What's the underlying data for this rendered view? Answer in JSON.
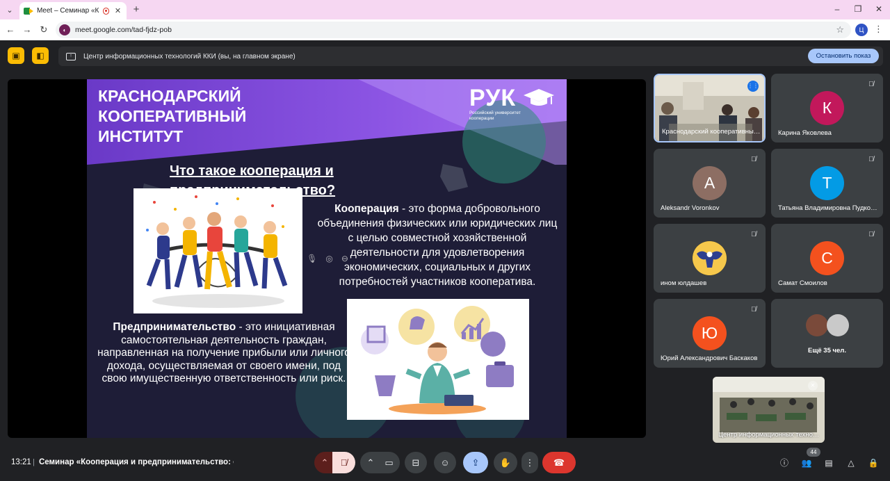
{
  "browser": {
    "tab_title": "Meet – Семинар «Коопер",
    "url": "meet.google.com/tad-fjdz-pob",
    "profile_initial": "Ц",
    "site_icon_label": "◐"
  },
  "presenting": {
    "banner_text": "Центр информационных технологий ККИ (вы, на главном экране)",
    "stop_button": "Остановить показ"
  },
  "slide": {
    "title_lines": [
      "КРАСНОДАРСКИЙ",
      "КООПЕРАТИВНЫЙ",
      "ИНСТИТУТ"
    ],
    "logo_name": "РУК",
    "logo_sub": "Российский университет кооперации",
    "question": "Что такое кооперация и предпринимательство?",
    "coop_term": "Кооперация",
    "coop_def": " - это форма добровольного объединения физических или юридических лиц с целью совместной хозяйственной деятельности для удовлетворения экономических, социальных и других потребностей участников кооператива.",
    "ent_term": "Предпринимательство",
    "ent_def": " - это инициативная самостоятельная деятельность граждан, направленная на получение прибыли или личного дохода, осуществляемая от своего имени, под свою имущественную ответственность или риск."
  },
  "participants": [
    {
      "name": "Краснодарский кооперативный институт",
      "initial": "",
      "color": "",
      "video": true,
      "speaking": true
    },
    {
      "name": "Карина Яковлева",
      "initial": "К",
      "color": "#c2185b",
      "muted": true
    },
    {
      "name": "Aleksandr Voronkov",
      "initial": "А",
      "color": "#8d6e63",
      "muted": true
    },
    {
      "name": "Татьяна Владимировна Пудковская",
      "initial": "Т",
      "color": "#039be5",
      "muted": true
    },
    {
      "name": "ином юлдашев",
      "initial": "",
      "color": "#f4b400",
      "muted": true
    },
    {
      "name": "Самат Смоилов",
      "initial": "С",
      "color": "#f4511e",
      "muted": true
    },
    {
      "name": "Юрий Александрович Баскаков",
      "initial": "Ю",
      "color": "#f4511e",
      "muted": true
    }
  ],
  "more": {
    "label": "Ещё 35 чел."
  },
  "self_view": {
    "label": "Центр информационных технологий ККИ"
  },
  "bottom": {
    "time": "13:21",
    "separator": "|",
    "meeting_title": "Семинар «Кооперация и предпринимательство: с...",
    "participant_count": "44"
  },
  "colors": {
    "meet_bg": "#202124",
    "tile_bg": "#3c4043",
    "accent_blue": "#a8c7fa",
    "hangup_red": "#dc362e",
    "slide_purple": "#7b4fd6"
  }
}
